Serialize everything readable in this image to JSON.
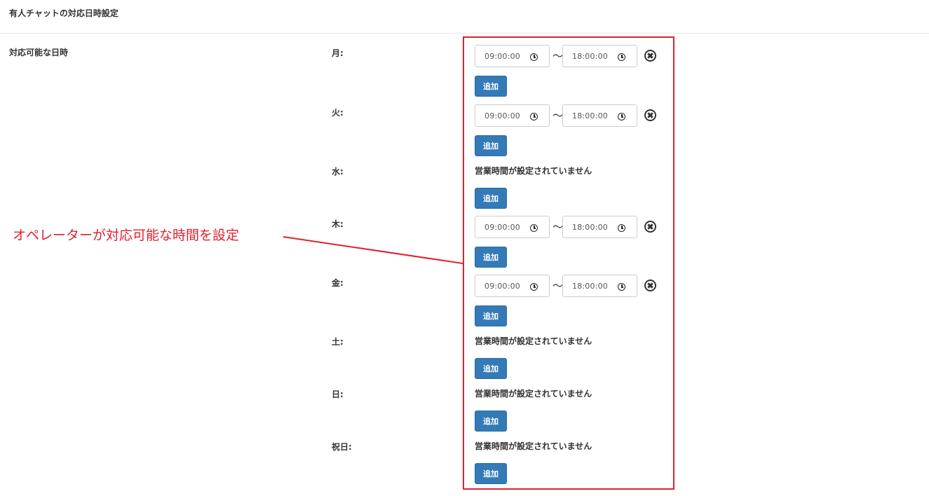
{
  "section_title": "有人チャットの対応日時設定",
  "field_label": "対応可能な日時",
  "separator": "〜",
  "add_label": "追加",
  "no_hours_text": "営業時間が設定されていません",
  "annotation": "オペレーターが対応可能な時間を設定",
  "highlight_color": "#e0202e",
  "button_color": "#337ab7",
  "days": [
    {
      "label": "月:",
      "start": "09:00:00",
      "end": "18:00:00"
    },
    {
      "label": "火:",
      "start": "09:00:00",
      "end": "18:00:00"
    },
    {
      "label": "水:"
    },
    {
      "label": "木:",
      "start": "09:00:00",
      "end": "18:00:00"
    },
    {
      "label": "金:",
      "start": "09:00:00",
      "end": "18:00:00"
    },
    {
      "label": "土:"
    },
    {
      "label": "日:"
    },
    {
      "label": "祝日:"
    }
  ]
}
